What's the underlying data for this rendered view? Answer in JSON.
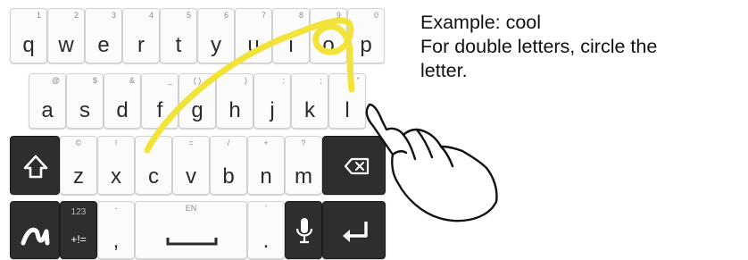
{
  "keyboard": {
    "row1": [
      {
        "id": "q",
        "label": "q",
        "hint": "1"
      },
      {
        "id": "w",
        "label": "w",
        "hint": "2"
      },
      {
        "id": "e",
        "label": "e",
        "hint": "3"
      },
      {
        "id": "r",
        "label": "r",
        "hint": "4"
      },
      {
        "id": "t",
        "label": "t",
        "hint": "5"
      },
      {
        "id": "y",
        "label": "y",
        "hint": "6"
      },
      {
        "id": "u",
        "label": "u",
        "hint": "7"
      },
      {
        "id": "i",
        "label": "i",
        "hint": "8"
      },
      {
        "id": "o",
        "label": "o",
        "hint": "9"
      },
      {
        "id": "p",
        "label": "p",
        "hint": "0"
      }
    ],
    "row2": [
      {
        "id": "a",
        "label": "a",
        "hint": "@"
      },
      {
        "id": "s",
        "label": "s",
        "hint": "$"
      },
      {
        "id": "d",
        "label": "d",
        "hint": "&"
      },
      {
        "id": "f",
        "label": "f",
        "hint": "_"
      },
      {
        "id": "g",
        "label": "g",
        "hint": "( )"
      },
      {
        "id": "h",
        "label": "h",
        "hint": ")"
      },
      {
        "id": "j",
        "label": "j",
        "hint": ":"
      },
      {
        "id": "k",
        "label": "k",
        "hint": ";"
      },
      {
        "id": "l",
        "label": "l",
        "hint": "\""
      }
    ],
    "row3": [
      {
        "id": "z",
        "label": "z",
        "hint": "©"
      },
      {
        "id": "x",
        "label": "x",
        "hint": "!"
      },
      {
        "id": "c",
        "label": "c",
        "hint": "'"
      },
      {
        "id": "v",
        "label": "v",
        "hint": "="
      },
      {
        "id": "b",
        "label": "b",
        "hint": "/"
      },
      {
        "id": "n",
        "label": "n",
        "hint": "+"
      },
      {
        "id": "m",
        "label": "m",
        "hint": "?"
      }
    ],
    "row4": {
      "symbols_label": "123",
      "symbols_sub": "+!=",
      "comma_label": ",",
      "comma_hint": "-",
      "space_hint": "EN",
      "period_label": ".",
      "period_hint": "'"
    },
    "icons": {
      "shift": "shift-icon",
      "backspace": "backspace-icon",
      "swype": "swype-icon",
      "mic": "microphone-icon",
      "enter": "enter-icon"
    },
    "colors": {
      "key_light": "#fbfbfb",
      "key_dark": "#2e2e2e",
      "trace": "#f2e33a"
    }
  },
  "instructions": {
    "line1": "Example: cool",
    "line2": "For double letters, circle the",
    "line3": "letter."
  }
}
